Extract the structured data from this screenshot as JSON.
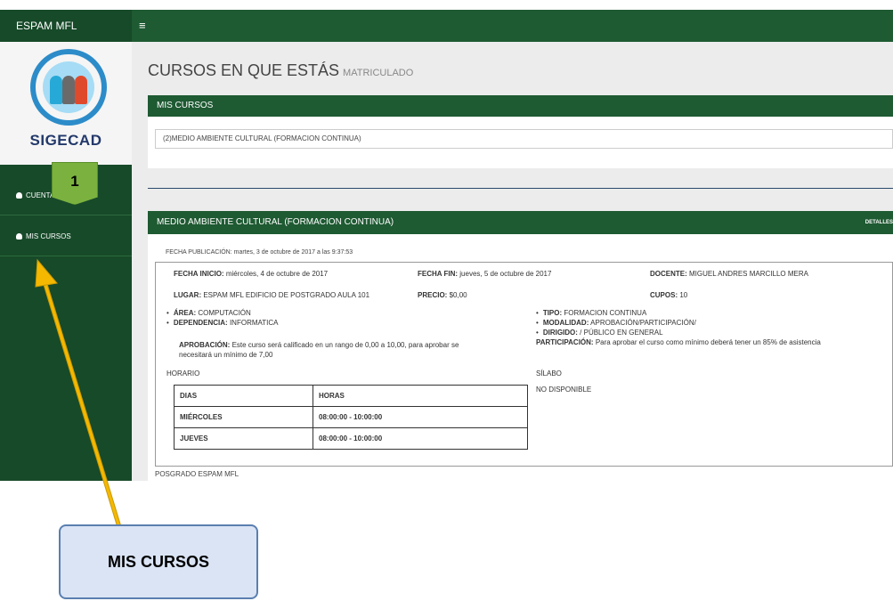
{
  "topbar": {
    "brand": "ESPAM MFL",
    "menu_icon": "≡"
  },
  "sidebar": {
    "logo_text": "SIGECAD",
    "items": [
      {
        "label": "CUENTA",
        "icon": "user-icon"
      },
      {
        "label": "MIS CURSOS",
        "icon": "user-icon"
      }
    ]
  },
  "badge": "1",
  "page": {
    "title": "CURSOS EN QUE ESTÁS",
    "subtitle": "MATRICULADO"
  },
  "mis_cursos": {
    "header": "MIS CURSOS",
    "selected": "(2)MEDIO AMBIENTE CULTURAL (FORMACION CONTINUA)"
  },
  "course": {
    "header": "MEDIO AMBIENTE CULTURAL (FORMACION CONTINUA)",
    "details_link": "DETALLES",
    "publicacion": "FECHA PUBLICACIÓN: martes, 3 de octubre de 2017 a las 9:37:53",
    "fecha_inicio_label": "FECHA INICIO:",
    "fecha_inicio": "miércoles, 4 de octubre de 2017",
    "fecha_fin_label": "FECHA FIN:",
    "fecha_fin": "jueves, 5 de octubre de 2017",
    "docente_label": "DOCENTE:",
    "docente": "MIGUEL ANDRES MARCILLO MERA",
    "lugar_label": "LUGAR:",
    "lugar": "ESPAM MFL EDIFICIO DE POSTGRADO AULA 101",
    "precio_label": "PRECIO:",
    "precio": "$0,00",
    "cupos_label": "CUPOS:",
    "cupos": "10",
    "area_label": "ÁREA:",
    "area": "COMPUTACIÓN",
    "dependencia_label": "DEPENDENCIA:",
    "dependencia": "INFORMATICA",
    "tipo_label": "TIPO:",
    "tipo": "FORMACION CONTINUA",
    "modalidad_label": "MODALIDAD:",
    "modalidad": "APROBACIÓN/PARTICIPACIÓN/",
    "dirigido_label": "DIRIGIDO:",
    "dirigido": "/ PÚBLICO EN GENERAL",
    "aprobacion_label": "APROBACIÓN:",
    "aprobacion_1": "Este curso será calificado en un rango de 0,00 a 10,00, para aprobar se",
    "aprobacion_2": "necesitará un mínimo de 7,00",
    "participacion_label": "PARTICIPACIÓN:",
    "participacion": "Para aprobar el curso como mínimo deberá tener un 85% de asistencia",
    "horario_label": "HORARIO",
    "silabo_label": "SÍLABO",
    "silabo_value": "NO DISPONIBLE",
    "schedule_headers": [
      "DIAS",
      "HORAS"
    ],
    "schedule_rows": [
      [
        "MIÉRCOLES",
        "08:00:00 - 10:00:00"
      ],
      [
        "JUEVES",
        "08:00:00 - 10:00:00"
      ]
    ],
    "footer": "POSGRADO ESPAM MFL"
  },
  "callout": "MIS CURSOS",
  "colors": {
    "green_dark": "#174a29",
    "green": "#1e5a32",
    "badge": "#7bb23f",
    "arrow": "#f5b800",
    "callout_bg": "#dae4f4"
  }
}
